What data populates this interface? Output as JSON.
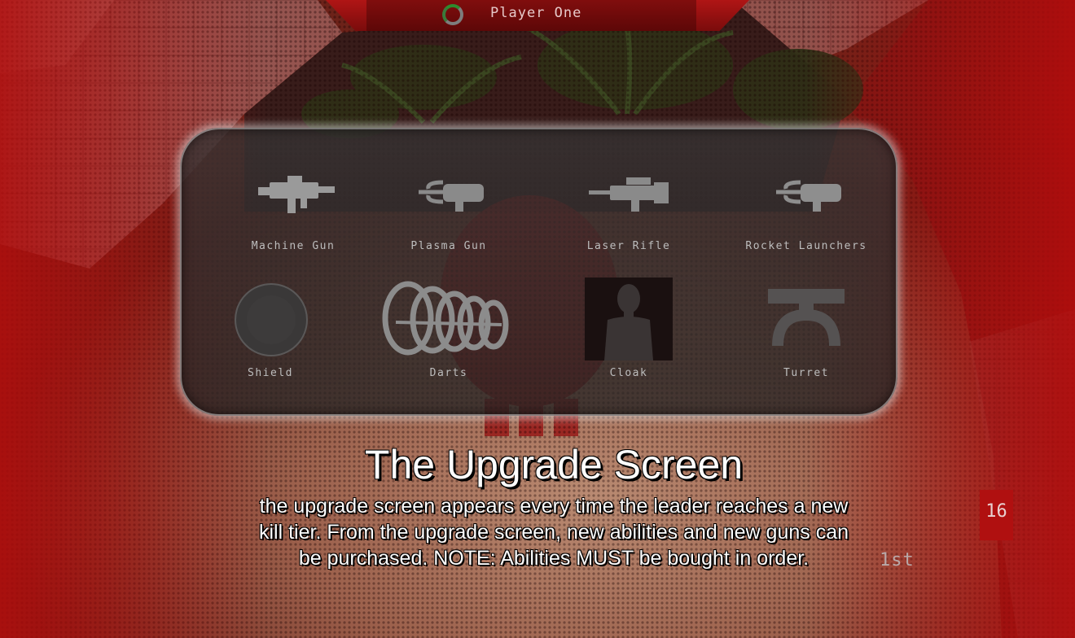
{
  "hud": {
    "player_name": "Player One",
    "score": "16",
    "rank": "1st"
  },
  "upgrades": [
    {
      "label": "Machine Gun",
      "icon": "machine-gun-icon"
    },
    {
      "label": "Plasma Gun",
      "icon": "plasma-gun-icon"
    },
    {
      "label": "Laser Rifle",
      "icon": "laser-rifle-icon"
    },
    {
      "label": "Rocket Launchers",
      "icon": "rocket-launcher-icon"
    },
    {
      "label": "Shield",
      "icon": "shield-icon"
    },
    {
      "label": "Darts",
      "icon": "darts-icon"
    },
    {
      "label": "Cloak",
      "icon": "cloak-icon"
    },
    {
      "label": "Turret",
      "icon": "turret-icon"
    }
  ],
  "caption": {
    "title": "The Upgrade Screen",
    "line1": "the upgrade screen appears every time the leader reaches a new",
    "line2": "kill tier.  From the upgrade screen, new abilities and new guns can",
    "line3": "be purchased.  NOTE: Abilities MUST be bought in order."
  },
  "colors": {
    "hud_red": "#b01010",
    "panel_border": "#d0d0d0",
    "caption_text": "#ffffff"
  }
}
